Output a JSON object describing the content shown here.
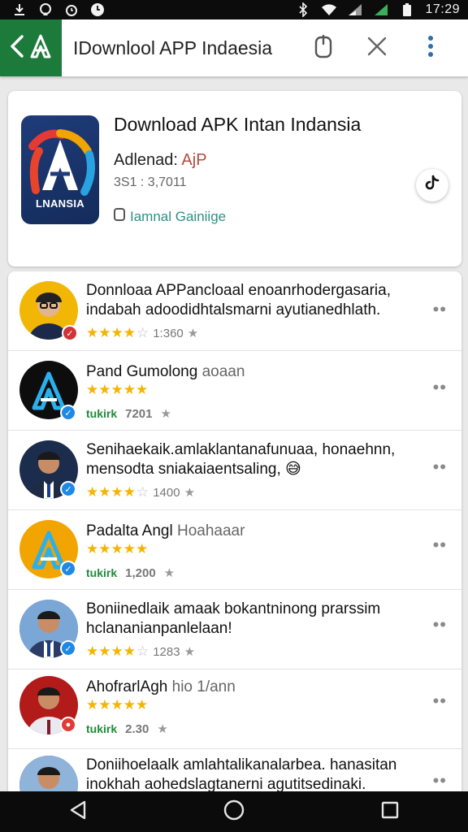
{
  "status_bar": {
    "time": "17:29",
    "icons_left": [
      "download-icon",
      "vpn-icon",
      "alarm-icon",
      "clock-icon"
    ],
    "icons_right": [
      "bluetooth-icon",
      "wifi-icon",
      "signal-icon",
      "signal-icon",
      "battery-icon"
    ]
  },
  "app_bar": {
    "title": "IDownlool APP Indaesia",
    "accent_color": "#1c7a3a",
    "back_icon": "back-arrow-icon",
    "logo_icon": "app-logo-icon",
    "actions": [
      "clipboard-icon",
      "close-icon",
      "more-vert-icon"
    ]
  },
  "header": {
    "title": "Download APK Intan Indansia",
    "subtitle_prefix": "Adlenad: ",
    "subtitle_accent": "AjP",
    "meta": "3S1 : 3,7011",
    "developer": "Iamnal Gainiige",
    "icon_label": "LNANSIA",
    "share_icon": "share-icon"
  },
  "list": [
    {
      "line1": "Donnloaa APPancloaal enoanrhodergasaria,",
      "line2": "indabah adoodidhtalsmarni ayutianedhlath.",
      "stars": 4,
      "count": "1:360",
      "avatar": "person",
      "badge_color": "#d13438",
      "bg": "#f2b705"
    },
    {
      "line1": "Pand Gumolong",
      "line1_muted": " aoaan",
      "stars": 5,
      "rating_label": "tukirk",
      "count": "7201",
      "avatar": "logo",
      "badge_color": "#1e88e5",
      "bg": "#0d0d0d"
    },
    {
      "line1": "Senihaekaik.amlaklantanafunuaa, honaehnn,",
      "line2": "mensodta sniakaiaentsaling,",
      "stars": 4,
      "count": "1400",
      "avatar": "person",
      "badge_color": "#1e88e5",
      "bg": "#1b2c4d"
    },
    {
      "line1": "Padalta Angl",
      "line1_muted": " Hoahaaar",
      "stars": 5,
      "rating_label": "tukirk",
      "count": "1,200",
      "avatar": "logo",
      "badge_color": "#1e88e5",
      "bg": "#f2a400"
    },
    {
      "line1": "Boniinedlaik amaak bokantninong prarssim",
      "line2": "hclananianpanlelaan!",
      "stars": 4,
      "count": "1283",
      "avatar": "person",
      "badge_color": "#1e88e5",
      "bg": "#3b6ea5"
    },
    {
      "line1": "AhofrarlAgh",
      "line1_muted": " hio 1/ann",
      "stars": 5,
      "rating_label": "tukirk",
      "count": "2.30",
      "avatar": "person",
      "badge_color": "#e53935",
      "bg": "#b31b1b"
    },
    {
      "line1": "Doniihoelaalk amlahtalikanalarbea. hanasitan",
      "line2": "inokhah aohedslagtanerni agutitsedinaki.",
      "avatar": "person",
      "badge_color": "#1e88e5",
      "bg": "#2f5d8a"
    }
  ],
  "nav_bar": {
    "buttons": [
      "back-triangle-icon",
      "home-circle-icon",
      "recents-square-icon"
    ]
  }
}
